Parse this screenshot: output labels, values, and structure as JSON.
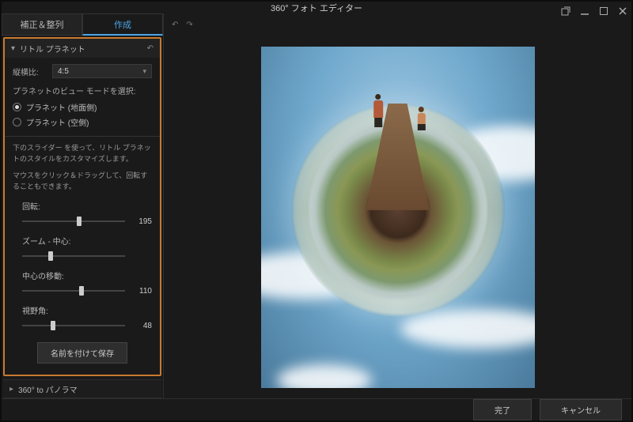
{
  "titlebar": {
    "title": "360° フォト エディター"
  },
  "tabs": {
    "correct": "補正＆整列",
    "create": "作成"
  },
  "little_planet": {
    "header": "リトル プラネット",
    "aspect_label": "縦横比:",
    "aspect_value": "4:5",
    "view_mode_label": "プラネットのビュー モードを選択:",
    "opt_ground": "プラネット (地面側)",
    "opt_sky": "プラネット (空側)",
    "help1": "下のスライダー を使って、リトル プラネットのスタイルをカスタマイズします。",
    "help2": "マウスをクリック＆ドラッグして、回転することもできます。",
    "sliders": {
      "rotation": {
        "label": "回転:",
        "value": "195",
        "pct": 55
      },
      "zoom": {
        "label": "ズーム - 中心:",
        "value": "",
        "pct": 28
      },
      "center": {
        "label": "中心の移動:",
        "value": "110",
        "pct": 58
      },
      "fov": {
        "label": "視野角:",
        "value": "48",
        "pct": 30
      }
    },
    "save_as": "名前を付けて保存"
  },
  "panorama_section": "360° to パノラマ",
  "footer": {
    "done": "完了",
    "cancel": "キャンセル"
  }
}
